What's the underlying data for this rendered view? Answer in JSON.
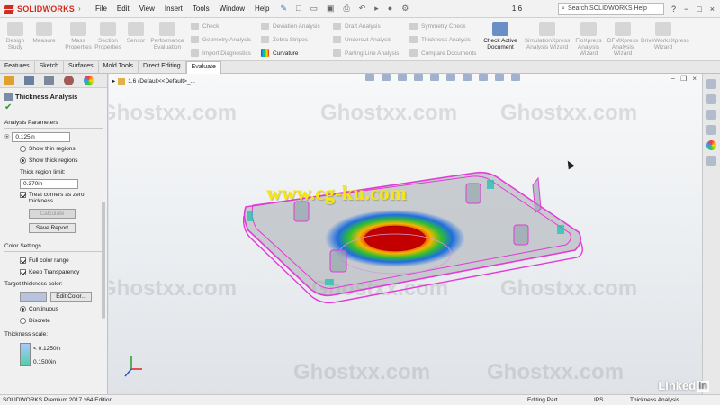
{
  "app": {
    "brand": "SOLIDWORKS",
    "menus": [
      "File",
      "Edit",
      "View",
      "Insert",
      "Tools",
      "Window",
      "Help"
    ],
    "doc_title": "1.6",
    "search_placeholder": "Search SOLIDWORKS Help",
    "window_controls": [
      "?",
      "−",
      "□",
      "×"
    ]
  },
  "ribbon": {
    "design_study": "Design Study",
    "measure": "Measure",
    "mass_properties": "Mass Properties",
    "section_properties": "Section Properties",
    "sensor": "Sensor",
    "performance_evaluation": "Performance Evaluation",
    "check": "Check",
    "geometry_analysis": "Geometry Analysis",
    "import_diagnostics": "Import Diagnostics",
    "deviation_analysis": "Deviation Analysis",
    "zebra_stripes": "Zebra Stripes",
    "curvature": "Curvature",
    "draft_analysis": "Draft Analysis",
    "undercut_analysis": "Undercut Analysis",
    "parting_line_analysis": "Parting Line Analysis",
    "symmetry_check": "Symmetry Check",
    "thickness_analysis": "Thickness Analysis",
    "compare_documents": "Compare Documents",
    "check_active_document": "Check Active Document",
    "simulationxpress": "SimulationXpress Analysis Wizard",
    "floxpress": "FloXpress Analysis Wizard",
    "dfmxpress": "DFMXpress Analysis Wizard",
    "driveworksxpress": "DriveWorksXpress Wizard"
  },
  "tabs": [
    "Features",
    "Sketch",
    "Surfaces",
    "Mold Tools",
    "Direct Editing",
    "Evaluate"
  ],
  "panel": {
    "title": "Thickness Analysis",
    "analysis_parameters": "Analysis Parameters",
    "target_thickness": "0.125in",
    "show_thin": "Show thin regions",
    "show_thick": "Show thick regions",
    "thick_limit_label": "Thick region limit:",
    "thick_limit": "0.370in",
    "treat_corners": "Treat corners as zero thickness",
    "calculate": "Calculate",
    "save_report": "Save Report",
    "color_settings": "Color Settings",
    "full_color_range": "Full color range",
    "keep_transparency": "Keep Transparency",
    "target_color_label": "Target thickness color:",
    "edit_color": "Edit Color...",
    "continuous": "Continuous",
    "discrete": "Discrete",
    "thickness_scale_label": "Thickness scale:",
    "scale_low": "< 0.1250in",
    "scale_high": "0.1500in"
  },
  "viewport": {
    "tree_label": "1.6  (Default<<Default>_...",
    "watermark": "Ghostxx.com",
    "overlay_url": "www.cg-ku.com"
  },
  "status": {
    "edition": "SOLIDWORKS Premium 2017 x64 Edition",
    "mode": "Editing Part",
    "units": "IPS",
    "name": "Thickness Analysis"
  },
  "linkedin": {
    "text": "Linked",
    "in": "in"
  }
}
